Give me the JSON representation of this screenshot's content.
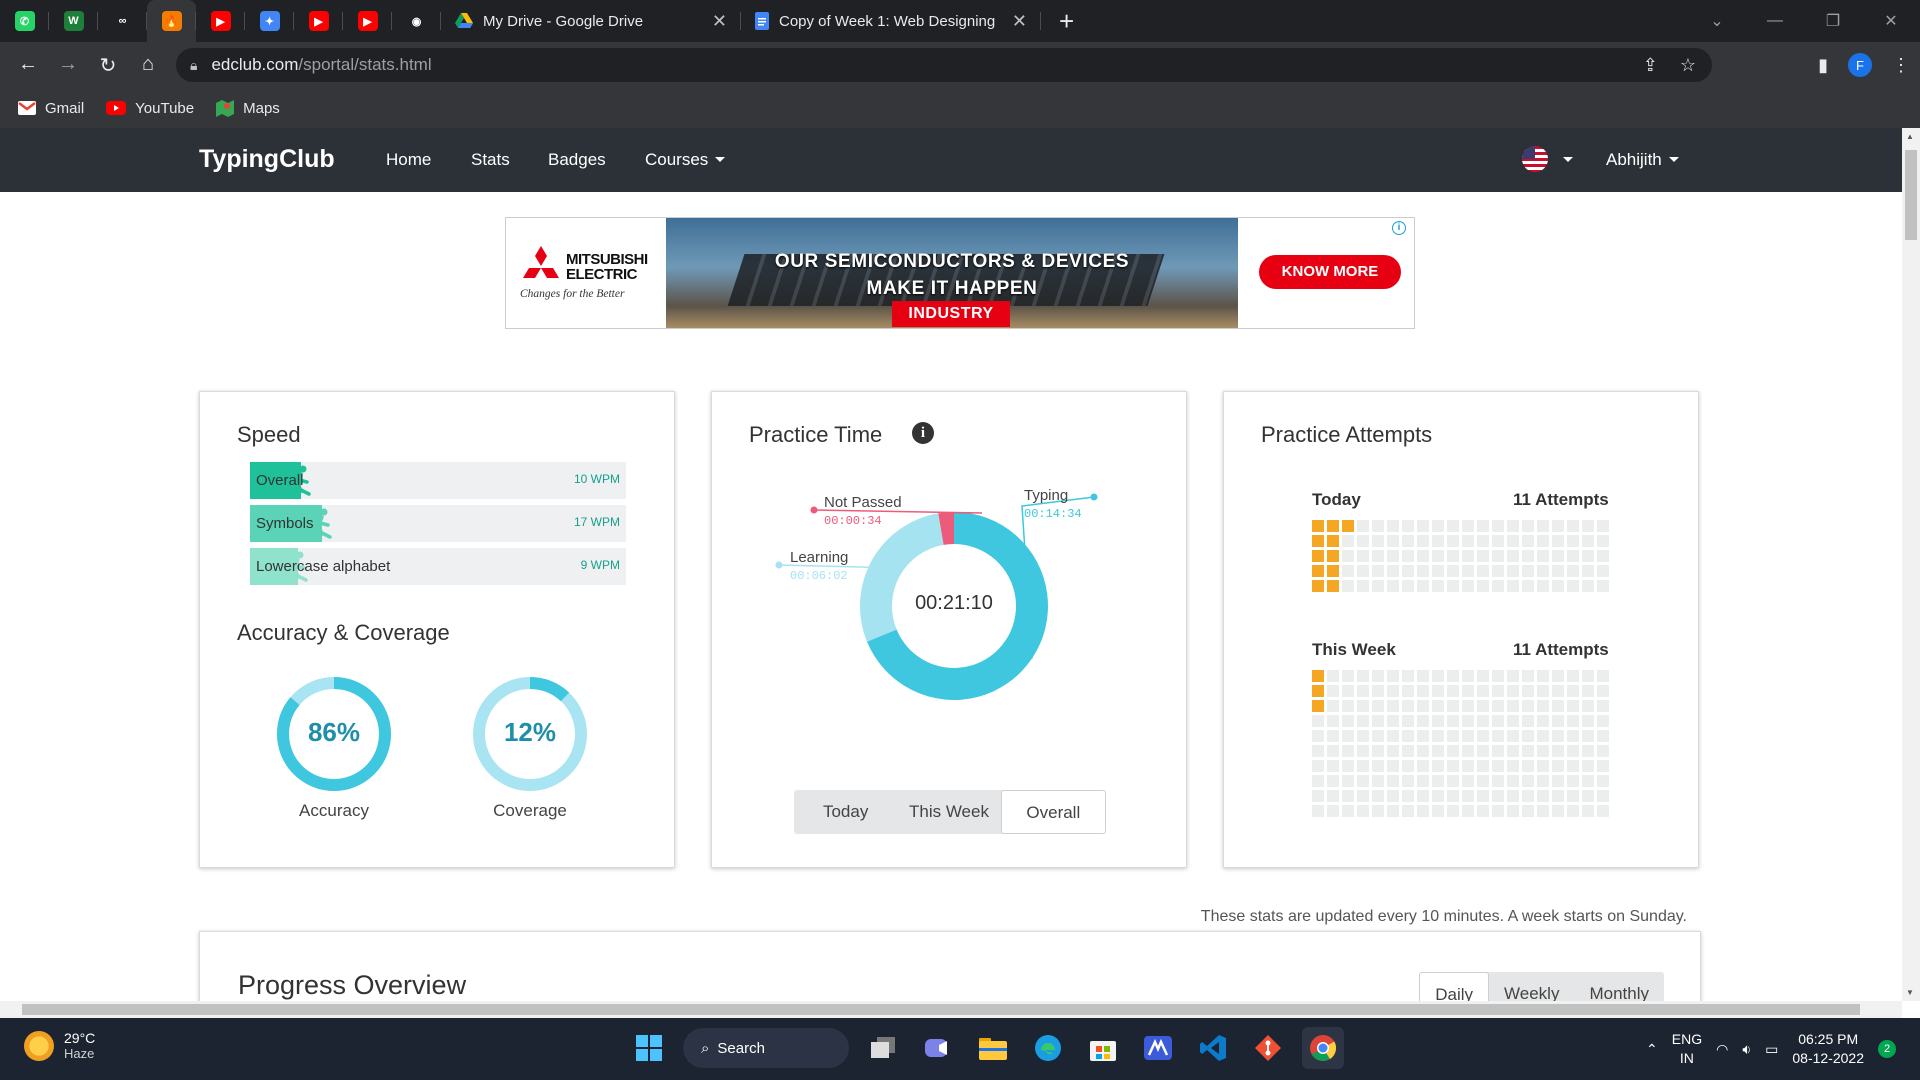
{
  "browser": {
    "pinned_tabs": [
      {
        "name": "whatsapp-icon",
        "color": "#25d366",
        "glyph": "✆"
      },
      {
        "name": "w-icon",
        "color": "#1e7f3a",
        "glyph": "W"
      },
      {
        "name": "infinity-icon",
        "color": "#202124",
        "glyph": "∞"
      },
      {
        "name": "flame-icon",
        "color": "#f57c00",
        "glyph": "🔥"
      },
      {
        "name": "youtube-icon",
        "color": "#ff0000",
        "glyph": "▶"
      },
      {
        "name": "colorful-icon",
        "color": "#4285f4",
        "glyph": "✦"
      },
      {
        "name": "youtube-icon",
        "color": "#ff0000",
        "glyph": "▶"
      },
      {
        "name": "youtube-icon",
        "color": "#ff0000",
        "glyph": "▶"
      },
      {
        "name": "github-icon",
        "color": "#202124",
        "glyph": "◉"
      }
    ],
    "tabs": [
      {
        "title": "My Drive - Google Drive",
        "icon": "google-drive-icon"
      },
      {
        "title": "Copy of Week 1: Web Designing",
        "icon": "google-docs-icon"
      }
    ],
    "url_host": "edclub.com",
    "url_path": "/sportal/stats.html",
    "profile_initial": "F",
    "bookmarks": [
      {
        "label": "Gmail",
        "icon": "gmail-icon",
        "color": "#ea4335"
      },
      {
        "label": "YouTube",
        "icon": "youtube-icon",
        "color": "#ff0000"
      },
      {
        "label": "Maps",
        "icon": "maps-icon",
        "color": "#34a853"
      }
    ]
  },
  "nav": {
    "brand": "TypingClub",
    "links": [
      "Home",
      "Stats",
      "Badges",
      "Courses"
    ],
    "user": "Abhijith"
  },
  "ad": {
    "brand": "MITSUBISHI ELECTRIC",
    "tagline": "Changes for the Better",
    "headline_1": "OUR SEMICONDUCTORS & DEVICES",
    "headline_2": "MAKE IT HAPPEN",
    "tag": "INDUSTRY",
    "cta": "KNOW MORE"
  },
  "speed": {
    "title": "Speed",
    "rows": [
      {
        "label": "Overall",
        "value": "10 WPM",
        "wpm": 10,
        "color": "#1fc19b"
      },
      {
        "label": "Symbols",
        "value": "17 WPM",
        "wpm": 17,
        "color": "#5ad3b6"
      },
      {
        "label": "Lowercase alphabet",
        "value": "9 WPM",
        "wpm": 9,
        "color": "#8fe3cd"
      }
    ]
  },
  "accuracy": {
    "title": "Accuracy & Coverage",
    "items": [
      {
        "label": "Accuracy",
        "value": "86%",
        "percent": 86
      },
      {
        "label": "Coverage",
        "value": "12%",
        "percent": 12
      }
    ]
  },
  "practice_time": {
    "title": "Practice Time",
    "total": "00:21:10",
    "segments": [
      {
        "label": "Typing",
        "time": "00:14:34",
        "seconds": 874,
        "color": "#3ec7de"
      },
      {
        "label": "Not Passed",
        "time": "00:00:34",
        "seconds": 34,
        "color": "#ee5a7a"
      },
      {
        "label": "Learning",
        "time": "00:06:02",
        "seconds": 362,
        "color": "#a6e3f1"
      }
    ],
    "ranges": [
      "Today",
      "This Week",
      "Overall"
    ],
    "selected_range": "Overall"
  },
  "attempts": {
    "title": "Practice Attempts",
    "today": {
      "label": "Today",
      "count": "11 Attempts",
      "filled": 11
    },
    "week": {
      "label": "This Week",
      "count": "11 Attempts",
      "filled": 3
    }
  },
  "footer_note": "These stats are updated every 10 minutes. A week starts on Sunday.",
  "progress": {
    "title": "Progress Overview",
    "ranges": [
      "Daily",
      "Weekly",
      "Monthly"
    ],
    "selected_range": "Daily"
  },
  "taskbar": {
    "temperature": "29°C",
    "weather": "Haze",
    "search_label": "Search",
    "language_1": "ENG",
    "language_2": "IN",
    "time": "06:25 PM",
    "date": "08-12-2022",
    "notifications": "2"
  }
}
